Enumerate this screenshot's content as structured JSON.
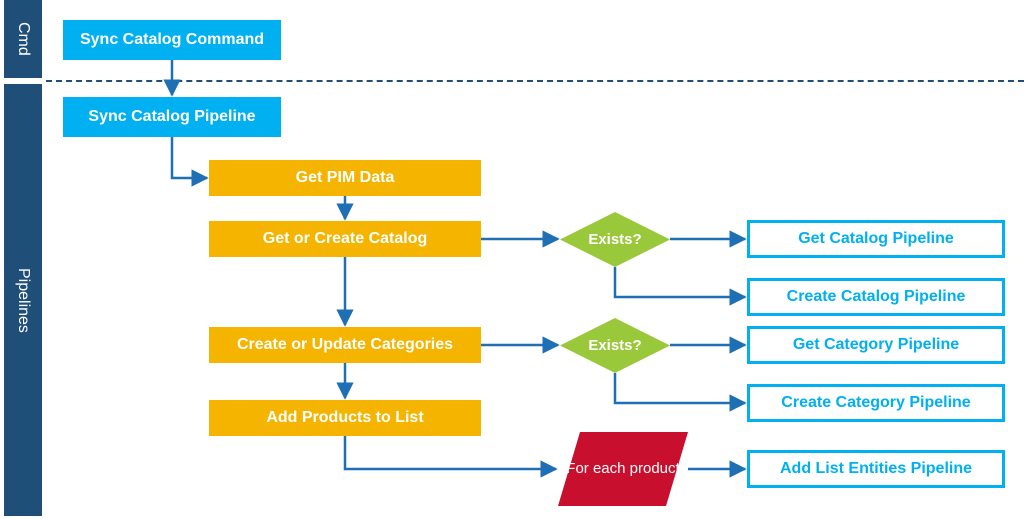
{
  "sections": {
    "cmd": "Cmd",
    "pipelines": "Pipelines"
  },
  "boxes": {
    "syncCatalogCommand": "Sync Catalog Command",
    "syncCatalogPipeline": "Sync Catalog Pipeline",
    "getPimData": "Get PIM Data",
    "getOrCreateCatalog": "Get or Create Catalog",
    "createOrUpdateCategories": "Create or Update Categories",
    "addProductsToList": "Add Products to List",
    "getCatalogPipeline": "Get Catalog Pipeline",
    "createCatalogPipeline": "Create Catalog Pipeline",
    "getCategoryPipeline": "Get Category Pipeline",
    "createCategoryPipeline": "Create Category Pipeline",
    "addListEntitiesPipeline": "Add List Entities Pipeline"
  },
  "decisions": {
    "exists1": "Exists?",
    "exists2": "Exists?"
  },
  "loop": {
    "forEachProduct": "For each product"
  },
  "chart_data": {
    "type": "flowchart",
    "swimlanes": [
      {
        "id": "cmd",
        "label": "Cmd"
      },
      {
        "id": "pipelines",
        "label": "Pipelines"
      }
    ],
    "nodes": [
      {
        "id": "syncCatalogCommand",
        "label": "Sync Catalog Command",
        "type": "process",
        "swimlane": "cmd"
      },
      {
        "id": "syncCatalogPipeline",
        "label": "Sync Catalog Pipeline",
        "type": "process",
        "swimlane": "pipelines"
      },
      {
        "id": "getPimData",
        "label": "Get PIM Data",
        "type": "step",
        "swimlane": "pipelines"
      },
      {
        "id": "getOrCreateCatalog",
        "label": "Get or Create Catalog",
        "type": "step",
        "swimlane": "pipelines"
      },
      {
        "id": "exists1",
        "label": "Exists?",
        "type": "decision",
        "swimlane": "pipelines"
      },
      {
        "id": "getCatalogPipeline",
        "label": "Get Catalog Pipeline",
        "type": "pipeline",
        "swimlane": "pipelines"
      },
      {
        "id": "createCatalogPipeline",
        "label": "Create Catalog Pipeline",
        "type": "pipeline",
        "swimlane": "pipelines"
      },
      {
        "id": "createOrUpdateCategories",
        "label": "Create or Update Categories",
        "type": "step",
        "swimlane": "pipelines"
      },
      {
        "id": "exists2",
        "label": "Exists?",
        "type": "decision",
        "swimlane": "pipelines"
      },
      {
        "id": "getCategoryPipeline",
        "label": "Get Category Pipeline",
        "type": "pipeline",
        "swimlane": "pipelines"
      },
      {
        "id": "createCategoryPipeline",
        "label": "Create Category Pipeline",
        "type": "pipeline",
        "swimlane": "pipelines"
      },
      {
        "id": "addProductsToList",
        "label": "Add Products to List",
        "type": "step",
        "swimlane": "pipelines"
      },
      {
        "id": "forEachProduct",
        "label": "For each product",
        "type": "loop",
        "swimlane": "pipelines"
      },
      {
        "id": "addListEntitiesPipeline",
        "label": "Add List Entities Pipeline",
        "type": "pipeline",
        "swimlane": "pipelines"
      }
    ],
    "edges": [
      {
        "from": "syncCatalogCommand",
        "to": "syncCatalogPipeline"
      },
      {
        "from": "syncCatalogPipeline",
        "to": "getPimData"
      },
      {
        "from": "getPimData",
        "to": "getOrCreateCatalog"
      },
      {
        "from": "getOrCreateCatalog",
        "to": "exists1"
      },
      {
        "from": "exists1",
        "to": "getCatalogPipeline"
      },
      {
        "from": "exists1",
        "to": "createCatalogPipeline"
      },
      {
        "from": "getOrCreateCatalog",
        "to": "createOrUpdateCategories"
      },
      {
        "from": "createOrUpdateCategories",
        "to": "exists2"
      },
      {
        "from": "exists2",
        "to": "getCategoryPipeline"
      },
      {
        "from": "exists2",
        "to": "createCategoryPipeline"
      },
      {
        "from": "createOrUpdateCategories",
        "to": "addProductsToList"
      },
      {
        "from": "addProductsToList",
        "to": "forEachProduct"
      },
      {
        "from": "forEachProduct",
        "to": "addListEntitiesPipeline"
      }
    ]
  }
}
